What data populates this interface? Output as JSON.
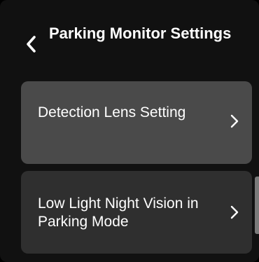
{
  "header": {
    "title": "Parking Monitor Settings",
    "back_icon": "chevron-left-icon"
  },
  "menu": {
    "items": [
      {
        "label": "Detection Lens Setting",
        "icon": "chevron-right-icon",
        "state": "highlighted"
      },
      {
        "label": "Low Light Night Vision in Parking Mode",
        "icon": "chevron-right-icon",
        "state": "normal"
      }
    ]
  },
  "colors": {
    "background": "#111111",
    "item_highlighted": "#4a4a4a",
    "item_normal": "#2f2f2f",
    "text": "#ffffff"
  }
}
